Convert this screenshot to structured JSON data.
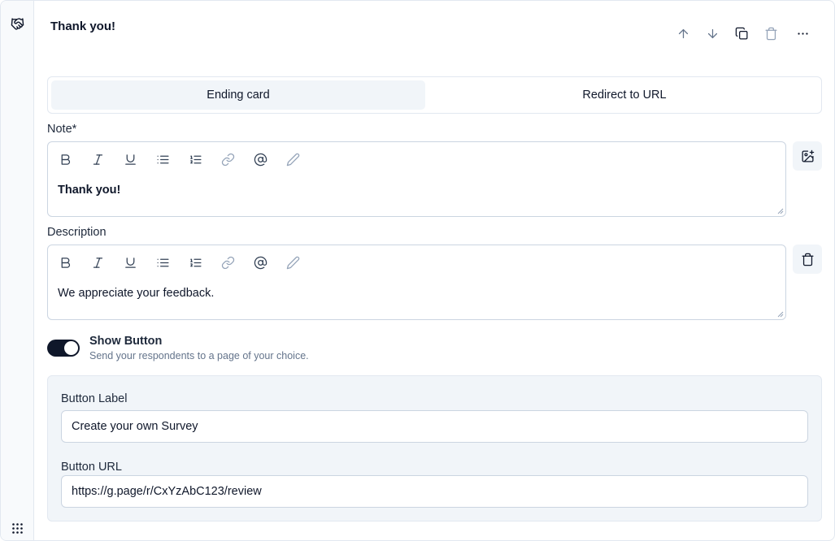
{
  "card": {
    "title": "Thank you!"
  },
  "header_actions": [
    {
      "name": "move-up-button",
      "icon": "arrow-up-icon"
    },
    {
      "name": "move-down-button",
      "icon": "arrow-down-icon"
    },
    {
      "name": "duplicate-button",
      "icon": "copy-icon"
    },
    {
      "name": "delete-button",
      "icon": "trash-icon"
    },
    {
      "name": "more-options-button",
      "icon": "more-horizontal-icon"
    }
  ],
  "tabs": {
    "ending": "Ending card",
    "redirect": "Redirect to URL",
    "active": "ending"
  },
  "note": {
    "label": "Note*",
    "content": "Thank you!"
  },
  "description": {
    "label": "Description",
    "content": "We appreciate your feedback."
  },
  "editor_toolbar": [
    "bold-icon",
    "italic-icon",
    "underline-icon",
    "bullet-list-icon",
    "numbered-list-icon",
    "link-icon",
    "mention-icon",
    "pencil-icon"
  ],
  "show_button": {
    "title": "Show Button",
    "description": "Send your respondents to a page of your choice.",
    "enabled": true
  },
  "button_label": {
    "label": "Button Label",
    "value": "Create your own Survey"
  },
  "button_url": {
    "label": "Button URL",
    "value": "https://g.page/r/CxYzAbC123/review"
  },
  "colors": {
    "accent": "#0f172a",
    "muted_bg": "#f1f5f9",
    "border": "#cbd5e1"
  }
}
